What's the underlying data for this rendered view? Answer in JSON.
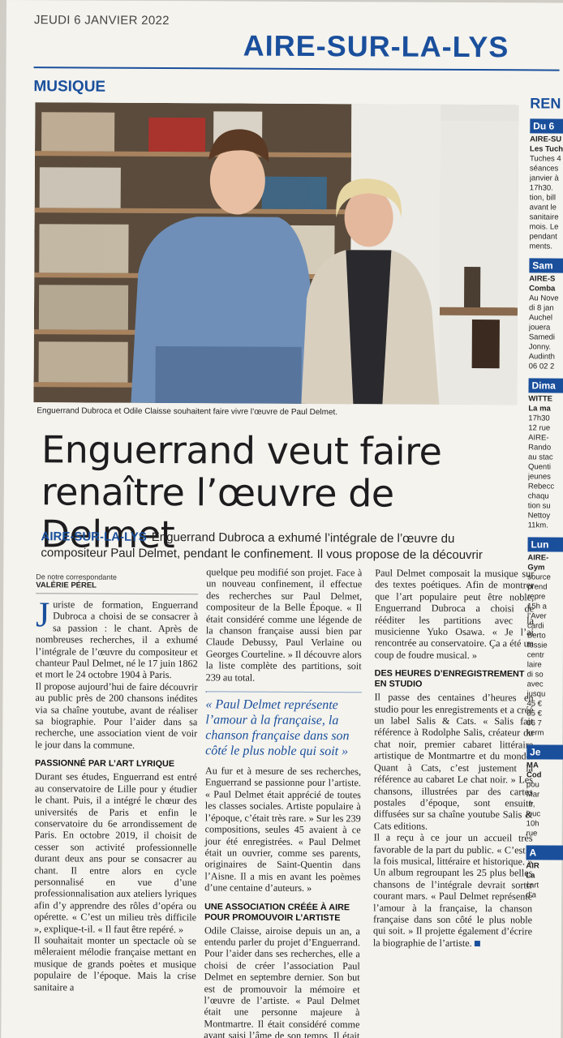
{
  "header": {
    "date": "JEUDI 6 JANVIER 2022",
    "city": "AIRE-SUR-LA-LYS",
    "rubric": "MUSIQUE"
  },
  "photo": {
    "caption": "Enguerrand Dubroca et Odile Claisse souhaitent faire vivre l’œuvre de Paul Delmet."
  },
  "article": {
    "title_line1": "Enguerrand veut faire",
    "title_line2": "renaître l’œuvre de Delmet",
    "chapo_location": "AIRE-SUR-LA-LYS",
    "chapo_text": "Enguerrand Dubroca a exhumé l’intégrale de l’œuvre du compositeur Paul Delmet, pendant le confinement. Il vous propose de la découvrir",
    "byline_label": "De notre correspondante",
    "byline_name": "VALÉRIE PÉREL",
    "dropcap": "J",
    "p1": "uriste de formation, Enguerrand Dubroca a choisi de se consacrer à sa passion : le chant. Après de nombreuses recherches, il a exhumé l’intégrale de l’œuvre du compositeur et chanteur Paul Delmet, né le 17 juin 1862 et mort le 24 octobre 1904 à Paris.",
    "p2": "Il propose aujourd’hui de faire découvrir au public près de 200 chansons inédites via sa chaîne youtube, avant de réaliser sa biographie. Pour l’aider dans sa recherche, une association vient de voir le jour dans la commune.",
    "sub1": "PASSIONNÉ PAR L’ART LYRIQUE",
    "p3": "Durant ses études, Enguerrand est entré au conservatoire de Lille pour y étudier le chant. Puis, il a intégré le chœur des universités de Paris et enfin le conservatoire du 6e arrondissement de Paris. En octobre 2019, il choisit de cesser son activité professionnelle durant deux ans pour se consacrer au chant. Il entre alors en cycle personnalisé en vue d’une professionnalisation aux ateliers lyriques afin d’y apprendre des rôles d’opéra ou opérette. « C’est un milieu très difficile », explique-t-il. « Il faut être repéré. »",
    "p4": "Il souhaitait monter un spectacle où se mêleraient mélodie française mettant en musique de grands poètes et musique populaire de l’époque. Mais la crise sanitaire a",
    "p5": "quelque peu modifié son projet. Face à un nouveau confinement, il effectue des recherches sur Paul Delmet, compositeur de la Belle Époque. « Il était considéré comme une légende de la chanson française aussi bien par Claude Debussy, Paul Verlaine ou Georges Courteline. » Il découvre alors la liste complète des partitions, soit 239 au total.",
    "quote": "« Paul Delmet représente l’amour à la française, la chanson française dans son côté le plus noble qui soit »",
    "p6": "Au fur et à mesure de ses recherches, Enguerrand se passionne pour l’artiste. « Paul Delmet était apprécié de toutes les classes sociales. Artiste populaire à l’époque, c’était très rare. » Sur les 239 compositions, seules 45 avaient à ce jour été enregistrées. « Paul Delmet était un ouvrier, comme ses parents, originaires de Saint-Quentin dans l’Aisne. Il a mis en avant les poèmes d’une centaine d’auteurs. »",
    "sub2": "UNE ASSOCIATION CRÉÉE À AIRE POUR PROMOUVOIR L’ARTISTE",
    "p7": "Odile Claisse, airoise depuis un an, a entendu parler du projet d’Enguerrand. Pour l’aider dans ses recherches, elle a choisi de créer l’association Paul Delmet en septembre dernier. Son but est de promouvoir la mémoire et l’œuvre de l’artiste. « Paul Delmet était une personne majeure à Montmartre. Il était considéré comme ayant saisi l’âme de son temps. Il était spécialisé dans l’amour avec quelques chansons humoristiques. Puis, il est tombé dans l’oubli. »",
    "p8": "Paul Delmet composait la musique sur des textes poétiques. Afin de montrer que l’art populaire peut être noble, Enguerrand Dubroca a choisi de rééditer les partitions avec la musicienne Yuko Osawa. « Je l’ai rencontrée au conservatoire. Ça a été un coup de foudre musical. »",
    "sub3": "DES HEURES D’ENREGISTREMENT EN STUDIO",
    "p9": "Il passe des centaines d’heures en studio pour les enregistrements et a créé un label Salis & Cats. « Salis fait référence à Rodolphe Salis, créateur du chat noir, premier cabaret littéraire artistique de Montmartre et du monde. Quant à Cats, c’est justement la référence au cabaret Le chat noir. » Les chansons, illustrées par des cartes postales d’époque, sont ensuite diffusées sur sa chaîne youtube Salis & Cats editions.",
    "p10": "Il a reçu à ce jour un accueil très favorable de la part du public. « C’est à la fois musical, littéraire et historique. » Un album regroupant les 25 plus belles chansons de l’intégrale devrait sortir courant mars. « Paul Delmet représente l’amour à la française, la chanson française dans son côté le plus noble qui soit. » Il projette également d’écrire la biographie de l’artiste."
  },
  "sidebar": {
    "head": "REN",
    "tab1": "Du 6",
    "t1": [
      "AIRE-SU",
      "Les Tuch",
      "Tuches 4",
      "séances",
      "janvier à",
      "17h30.",
      "tion, bill",
      "avant le",
      "sanitaire",
      "mois. Le",
      "pendant",
      "ments."
    ],
    "tab2": "Sam",
    "t2": [
      "AIRE-S",
      "Comba",
      "Au Nove",
      "di 8 jan",
      "Auchel",
      "jouera",
      "Samedi",
      "Jonny.",
      "Audinth",
      "06 02 2"
    ],
    "tab3": "Dima",
    "t3": [
      "WITTE",
      "La ma",
      "17h30",
      "12 rue",
      "AIRE-",
      "Rando",
      "au stac",
      "Quenti",
      "jeunes",
      "Rebecc",
      "chaqu",
      "tion su",
      "Nettoy",
      "11km."
    ],
    "tab4": "Lun",
    "t4": [
      "AIRE-",
      "Gym",
      "source",
      "prend",
      "repre",
      "15h a",
      "l’Aver",
      "cardi",
      "Berto",
      "fessie",
      "centr",
      "laire",
      "di so",
      "avec",
      "jusqu",
      "45 €",
      "85 €",
      "06 7",
      "kerm"
    ],
    "tab5": "Je",
    "t5": [
      "MA",
      "Cod",
      "pou",
      "Mar",
      ".fr,",
      "jeuc",
      "10h",
      "rue"
    ],
    "tab6": "A",
    "t6": [
      "AIR",
      "La",
      "cart",
      "d’a"
    ]
  }
}
